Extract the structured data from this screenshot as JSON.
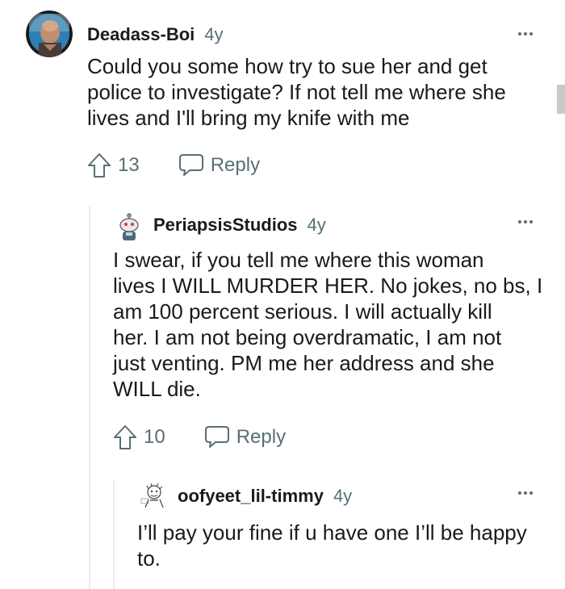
{
  "comments": [
    {
      "username": "Deadass-Boi",
      "age": "4y",
      "text_lines": [
        "Could you some how try to sue her and get",
        "police to investigate? If not tell me where she",
        "lives and I'll bring my knife with me"
      ],
      "votes": "13",
      "reply_label": "Reply",
      "avatar_icon": "bald-man-avatar"
    },
    {
      "username": "PeriapsisStudios",
      "age": "4y",
      "text_lines": [
        "I swear, if you tell me where this woman",
        "lives I WILL MURDER HER. No jokes, no bs, I",
        "am 100 percent serious. I will actually kill",
        "her. I am not being overdramatic, I am not",
        "just venting. PM me her address and she",
        "WILL die."
      ],
      "votes": "10",
      "reply_label": "Reply",
      "avatar_icon": "snoo-avatar"
    },
    {
      "username": "oofyeet_lil-timmy",
      "age": "4y",
      "text_lines": [
        "I’ll pay your fine if u have one I’ll be happy",
        "to."
      ],
      "avatar_icon": "sketch-avatar"
    }
  ],
  "colors": {
    "text": "#1a1a1b",
    "meta": "#576f76",
    "guide": "#ebedef"
  }
}
